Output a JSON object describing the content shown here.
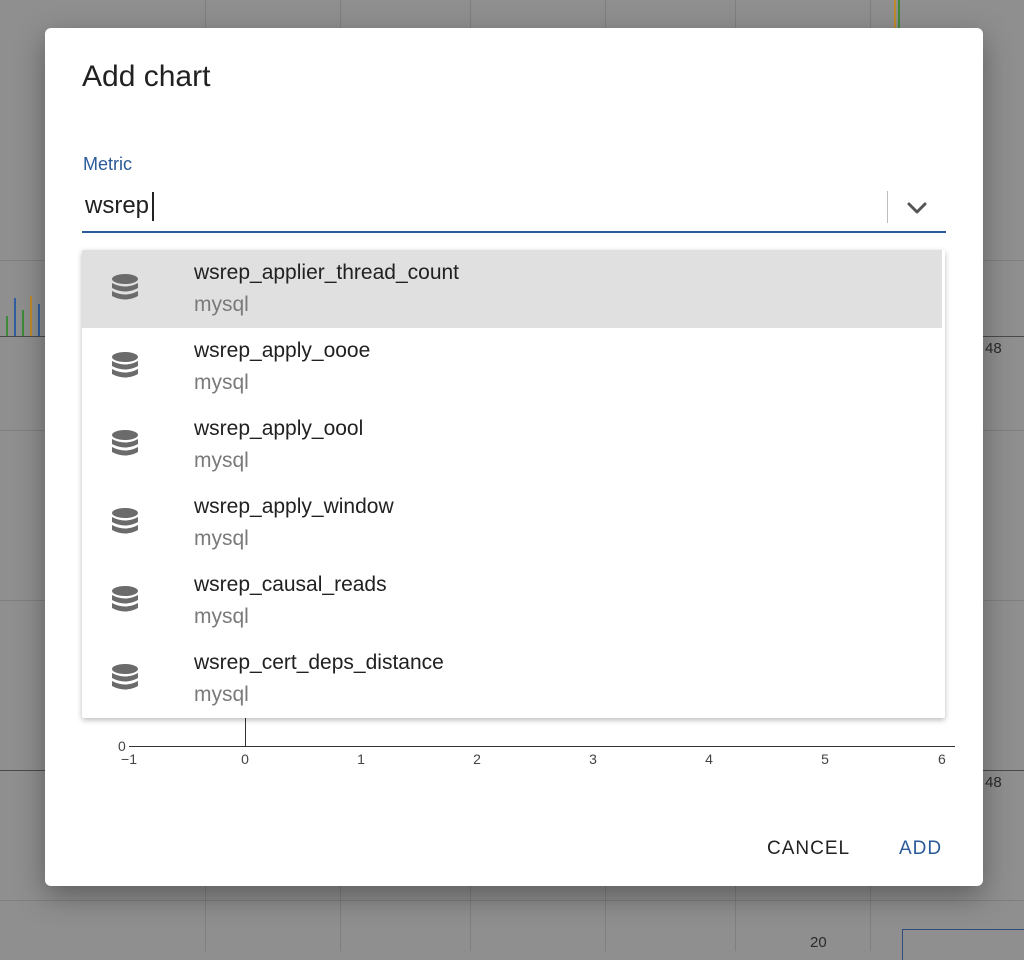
{
  "dialog": {
    "title": "Add chart",
    "metric_label": "Metric",
    "metric_value": "wsrep",
    "cancel_label": "CANCEL",
    "add_label": "ADD"
  },
  "suggestions": [
    {
      "name": "wsrep_applier_thread_count",
      "source": "mysql",
      "icon": "database-icon",
      "highlighted": true
    },
    {
      "name": "wsrep_apply_oooe",
      "source": "mysql",
      "icon": "database-icon"
    },
    {
      "name": "wsrep_apply_oool",
      "source": "mysql",
      "icon": "database-icon"
    },
    {
      "name": "wsrep_apply_window",
      "source": "mysql",
      "icon": "database-icon"
    },
    {
      "name": "wsrep_causal_reads",
      "source": "mysql",
      "icon": "database-icon"
    },
    {
      "name": "wsrep_cert_deps_distance",
      "source": "mysql",
      "icon": "database-icon"
    }
  ],
  "preview_chart": {
    "x_ticks": [
      "−1",
      "0",
      "1",
      "2",
      "3",
      "4",
      "5",
      "6"
    ],
    "y_ticks": [
      "0"
    ]
  },
  "background": {
    "tick_labels": [
      "48",
      "48",
      "20"
    ]
  },
  "colors": {
    "accent": "#2a5a98",
    "highlight": "#e0e0e0",
    "overlay": "#8f8f8f"
  }
}
